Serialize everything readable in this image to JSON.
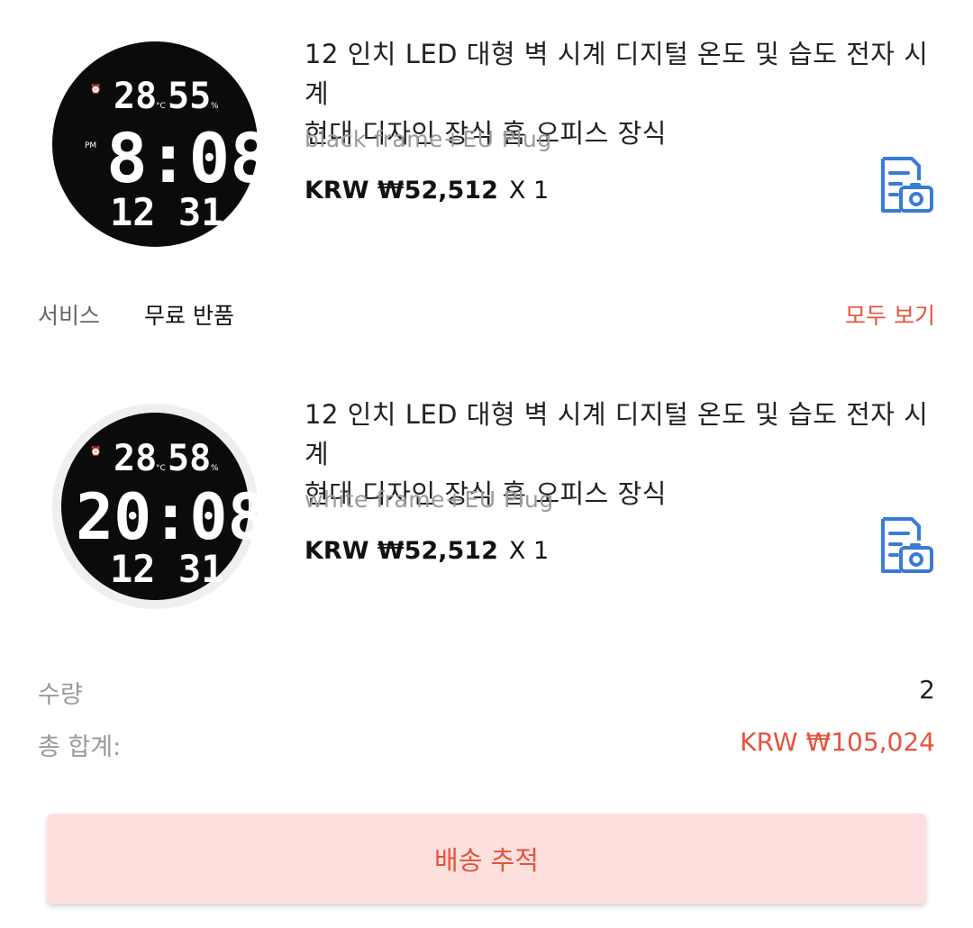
{
  "items": [
    {
      "title_line1": "12 인치 LED 대형 벽 시계 디지털 온도 및 습도 전자 시계",
      "title_line2": "현대 디자인 장식 홈 오피스 장식",
      "variant": "black frame+EU Plug",
      "price": "KRW ₩52,512",
      "qty": "X 1",
      "clock": {
        "temp": "28",
        "humidity": "55",
        "time": "8:08",
        "ampm": "PM",
        "date": "12 31",
        "frame": "#111111"
      }
    },
    {
      "title_line1": "12 인치 LED 대형 벽 시계 디지털 온도 및 습도 전자 시계",
      "title_line2": "현대 디자인 장식 홈 오피스 장식",
      "variant": "white frame+EU Plug",
      "price": "KRW ₩52,512",
      "qty": "X 1",
      "clock": {
        "temp": "28",
        "humidity": "58",
        "time": "20:08",
        "date": "12 31",
        "frame": "#f3f3f3"
      }
    }
  ],
  "service": {
    "label": "서비스",
    "value": "무료 반품",
    "view_all": "모두 보기"
  },
  "summary": {
    "quantity_label": "수량",
    "quantity_value": "2",
    "total_label": "총 합계:",
    "total_value": "KRW ₩105,024"
  },
  "track_button": "배송 추적",
  "icons": {
    "review": "photo-review-icon"
  },
  "colors": {
    "accent": "#e5533c",
    "button_bg": "#fde0de",
    "icon_blue": "#3a7bd5"
  }
}
